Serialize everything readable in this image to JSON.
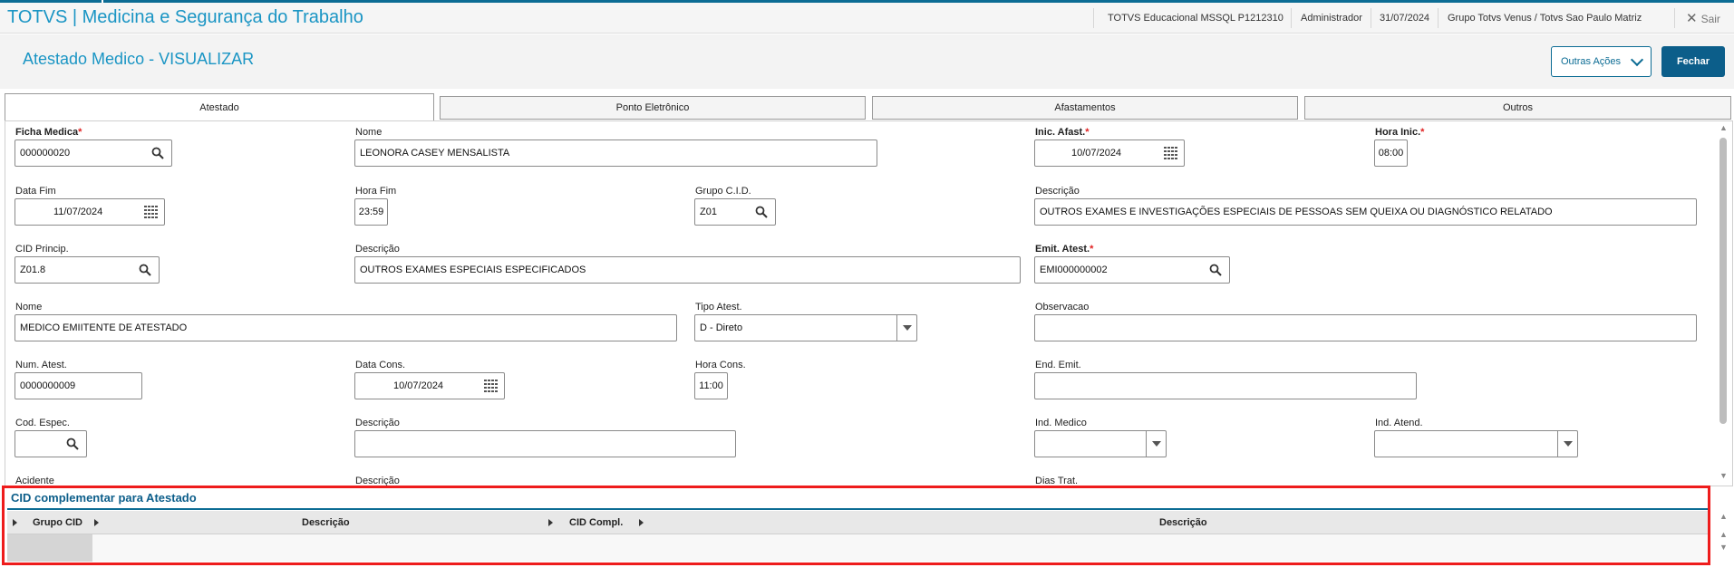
{
  "app": {
    "title": "TOTVS | Medicina e Segurança do Trabalho"
  },
  "topbar": {
    "environment": "TOTVS Educacional MSSQL P1212310",
    "user": "Administrador",
    "date": "31/07/2024",
    "company": "Grupo Totvs Venus / Totvs Sao Paulo Matriz",
    "exit_label": "Sair"
  },
  "header": {
    "title": "Atestado Medico - VISUALIZAR",
    "other_actions_label": "Outras Ações",
    "close_label": "Fechar"
  },
  "tabs": [
    {
      "label": "Atestado",
      "active": true
    },
    {
      "label": "Ponto Eletrônico",
      "active": false
    },
    {
      "label": "Afastamentos",
      "active": false
    },
    {
      "label": "Outros",
      "active": false
    }
  ],
  "form": {
    "ficha_medica": {
      "label": "Ficha Medica",
      "value": "000000020",
      "required": "*"
    },
    "nome": {
      "label": "Nome",
      "value": "LEONORA CASEY MENSALISTA"
    },
    "inic_afast": {
      "label": "Inic. Afast.",
      "value": "10/07/2024",
      "required": "*"
    },
    "hora_inic": {
      "label": "Hora Inic.",
      "value": "08:00",
      "required": "*"
    },
    "data_fim": {
      "label": "Data Fim",
      "value": "11/07/2024"
    },
    "hora_fim": {
      "label": "Hora Fim",
      "value": "23:59"
    },
    "grupo_cid": {
      "label": "Grupo C.I.D.",
      "value": "Z01"
    },
    "descricao_grupo": {
      "label": "Descrição",
      "value": "OUTROS EXAMES E INVESTIGAÇÕES ESPECIAIS DE PESSOAS SEM QUEIXA OU DIAGNÓSTICO RELATADO"
    },
    "cid_princip": {
      "label": "CID Princip.",
      "value": "Z01.8"
    },
    "descricao_cid": {
      "label": "Descrição",
      "value": "OUTROS EXAMES ESPECIAIS ESPECIFICADOS"
    },
    "emit_atest": {
      "label": "Emit. Atest.",
      "value": "EMI000000002",
      "required": "*"
    },
    "nome_emitente": {
      "label": "Nome",
      "value": "MEDICO EMIITENTE DE ATESTADO"
    },
    "tipo_atest": {
      "label": "Tipo Atest.",
      "value": "D - Direto"
    },
    "observacao": {
      "label": "Observacao",
      "value": ""
    },
    "num_atest": {
      "label": "Num. Atest.",
      "value": "0000000009"
    },
    "data_cons": {
      "label": "Data Cons.",
      "value": "10/07/2024"
    },
    "hora_cons": {
      "label": "Hora Cons.",
      "value": "11:00"
    },
    "end_emit": {
      "label": "End. Emit.",
      "value": ""
    },
    "cod_espec": {
      "label": "Cod. Espec.",
      "value": ""
    },
    "descricao_espec": {
      "label": "Descrição",
      "value": ""
    },
    "ind_medico": {
      "label": "Ind. Medico",
      "value": ""
    },
    "ind_atend": {
      "label": "Ind. Atend.",
      "value": ""
    },
    "acidente": {
      "label": "Acidente"
    },
    "descricao_acidente": {
      "label": "Descrição"
    },
    "dias_trat": {
      "label": "Dias Trat."
    }
  },
  "cid_complementar": {
    "title": "CID complementar para Atestado",
    "columns": [
      "Grupo CID",
      "Descrição",
      "CID Compl.",
      "Descrição"
    ]
  },
  "colors": {
    "accent": "#1a95c4",
    "primary": "#0c5e8a",
    "highlight_border": "#ee1c1c",
    "required": "#e02020"
  }
}
